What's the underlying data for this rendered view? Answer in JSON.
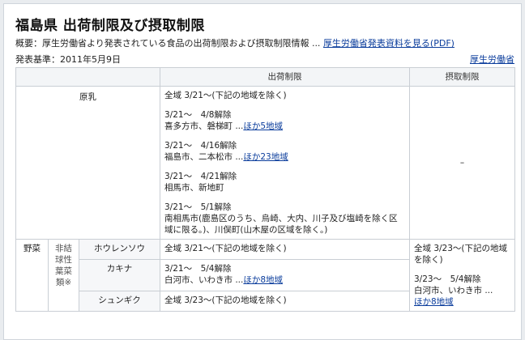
{
  "header": {
    "title": "福島県 出荷制限及び摂取制限",
    "summary_text": "概要：厚生労働省より発表されている食品の出荷制限および摂取制限情報 ...",
    "summary_link": "厚生労働省発表資料を見る(PDF)",
    "basis_date": "発表基準：2011年5月9日",
    "source_link": "厚生労働省"
  },
  "table": {
    "headers": [
      "出荷制限",
      "摂取制限"
    ],
    "milk": {
      "label": "原乳",
      "all_area": "全域 3/21～(下記の地域を除く)",
      "entries": [
        {
          "date": "3/21～　4/8解除",
          "places": "喜多方市、磐梯町 ...",
          "more": "ほか5地域"
        },
        {
          "date": "3/21～　4/16解除",
          "places": "福島市、二本松市 ...",
          "more": "ほか23地域"
        },
        {
          "date": "3/21～　4/21解除",
          "places": "相馬市、新地町",
          "more": ""
        },
        {
          "date": "3/21～　5/1解除",
          "places": "南相馬市(鹿島区のうち、烏崎、大内、川子及び塩崎を除く区域に限る。)、川俣町(山木屋の区域を除く。)",
          "more": ""
        }
      ],
      "intake": "–"
    },
    "vegetables": {
      "group": "野菜",
      "subgroup": "非結球性葉菜類※",
      "items": [
        {
          "name": "ホウレンソウ",
          "shipping": "全域 3/21～(下記の地域を除く)"
        },
        {
          "name": "カキナ",
          "shipping_date": "3/21～　5/4解除",
          "shipping_places": "白河市、いわき市 ...",
          "shipping_more": "ほか8地域"
        },
        {
          "name": "シュンギク",
          "shipping": "全域 3/23～(下記の地域を除く)"
        }
      ],
      "intake": {
        "all_area": "全域 3/23～(下記の地域を除く)",
        "date": "3/23～　5/4解除",
        "places": "白河市、いわき市 ...",
        "more": "ほか8地域"
      }
    }
  }
}
